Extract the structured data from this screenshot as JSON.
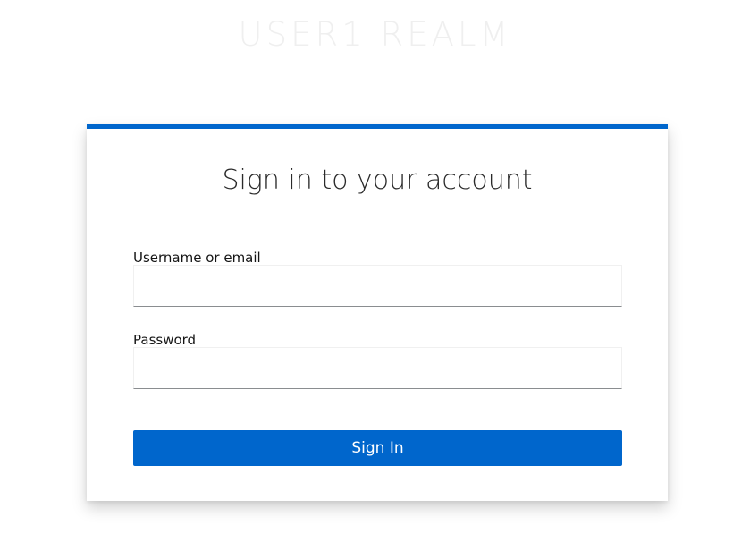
{
  "realm": {
    "title": "USER1 REALM"
  },
  "login_card": {
    "heading": "Sign in to your account",
    "accent_color": "#0066cc",
    "username": {
      "label": "Username or email",
      "value": "",
      "placeholder": ""
    },
    "password": {
      "label": "Password",
      "value": "",
      "placeholder": ""
    },
    "submit": {
      "label": "Sign In",
      "color": "#0066cc"
    }
  }
}
